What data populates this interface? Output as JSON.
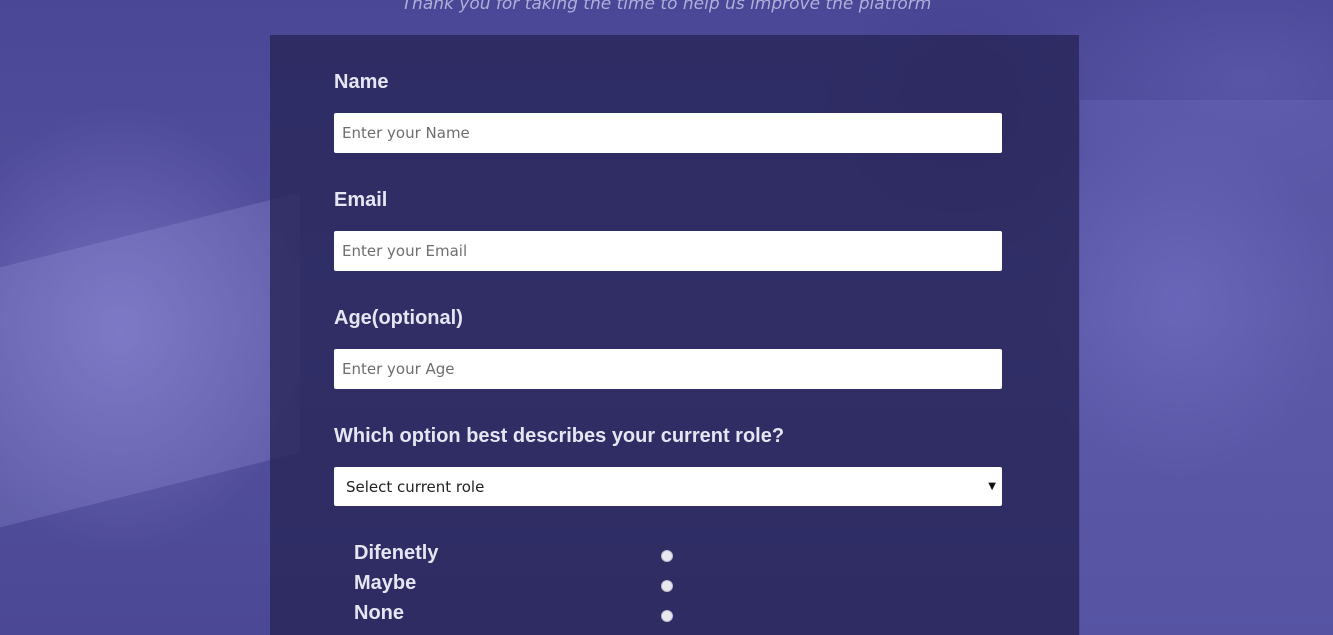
{
  "header": {
    "tagline": "Thank you for taking the time to help us improve the platform"
  },
  "form": {
    "name": {
      "label": "Name",
      "placeholder": "Enter your Name",
      "value": ""
    },
    "email": {
      "label": "Email",
      "placeholder": "Enter your Email",
      "value": ""
    },
    "age": {
      "label": "Age(optional)",
      "placeholder": "Enter your Age",
      "value": ""
    },
    "role": {
      "label": "Which option best describes your current role?",
      "selected": "Select current role"
    },
    "recommend": {
      "options": [
        {
          "label": "Difenetly",
          "checked": false
        },
        {
          "label": "Maybe",
          "checked": false
        },
        {
          "label": "None",
          "checked": false
        }
      ]
    }
  }
}
